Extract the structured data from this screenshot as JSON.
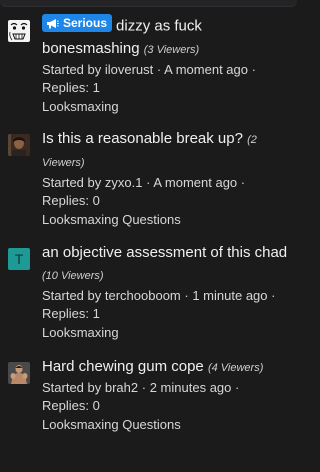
{
  "threads": [
    {
      "badge": "Serious",
      "title": "dizzy as fuck bonesmashing",
      "viewers": "(3 Viewers)",
      "started_by": "Started by iloverust",
      "time": "A moment ago",
      "replies": "Replies: 1",
      "forum": "Looksmaxing",
      "avatar_icon": "meme-face-avatar"
    },
    {
      "title": "Is this a reasonable break up?",
      "viewers": "(2 Viewers)",
      "started_by": "Started by zyxo.1",
      "time": "A moment ago",
      "replies": "Replies: 0",
      "forum": "Looksmaxing Questions",
      "avatar_icon": "photo-avatar"
    },
    {
      "title": "an objective assessment of this chad",
      "viewers": "(10 Viewers)",
      "started_by": "Started by terchooboom",
      "time": "1 minute ago",
      "replies": "Replies: 1",
      "forum": "Looksmaxing",
      "avatar_letter": "T",
      "avatar_color": "#1e9a96"
    },
    {
      "title": "Hard chewing gum cope",
      "viewers": "(4 Viewers)",
      "started_by": "Started by brah2",
      "time": "2 minutes ago",
      "replies": "Replies: 0",
      "forum": "Looksmaxing Questions",
      "avatar_icon": "muscle-photo-avatar"
    }
  ],
  "separator": "·",
  "colors": {
    "badge_blue": "#1e86e6",
    "background": "#1b1b1c"
  }
}
